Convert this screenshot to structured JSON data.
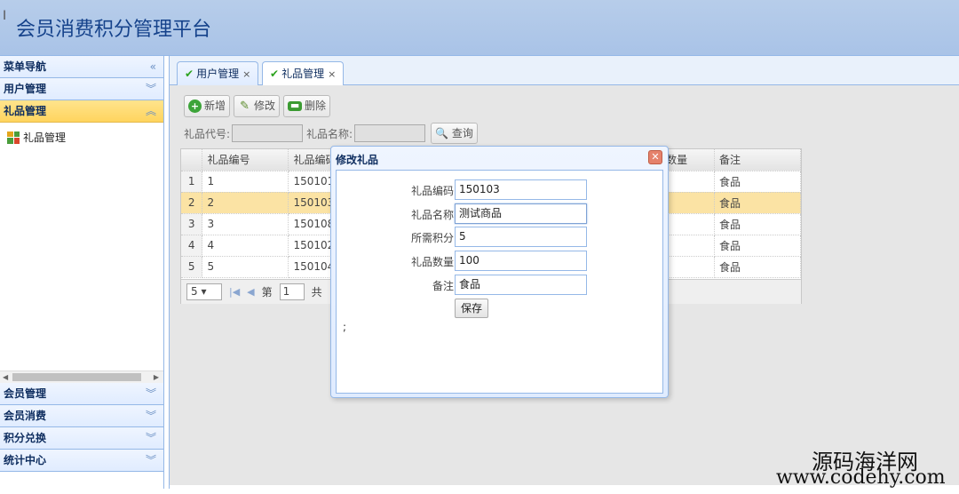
{
  "header": {
    "title": "会员消费积分管理平台"
  },
  "sidebar": {
    "nav_title": "菜单导航",
    "sections_top": [
      {
        "label": "用户管理"
      },
      {
        "label": "礼品管理",
        "active": true
      }
    ],
    "tree_item": "礼品管理",
    "sections_bottom": [
      {
        "label": "会员管理"
      },
      {
        "label": "会员消费"
      },
      {
        "label": "积分兑换"
      },
      {
        "label": "统计中心"
      }
    ]
  },
  "tabs": [
    {
      "label": "用户管理"
    },
    {
      "label": "礼品管理",
      "active": true
    }
  ],
  "toolbar": {
    "add": "新增",
    "edit": "修改",
    "delete": "删除"
  },
  "search": {
    "code_label": "礼品代号:",
    "name_label": "礼品名称:",
    "query": "查询"
  },
  "grid": {
    "columns": [
      "礼品编号",
      "礼品编码",
      "",
      "",
      "",
      "量",
      "备注"
    ],
    "header_visible": {
      "c1": "礼品编号",
      "c2": "礼品编码",
      "c5": "数量",
      "c6": "备注"
    },
    "rows": [
      {
        "rn": "1",
        "id": "1",
        "code": "150101",
        "note": "食品"
      },
      {
        "rn": "2",
        "id": "2",
        "code": "150103",
        "note": "食品",
        "selected": true
      },
      {
        "rn": "3",
        "id": "3",
        "code": "150108",
        "note": "食品"
      },
      {
        "rn": "4",
        "id": "4",
        "code": "150102",
        "note": "食品"
      },
      {
        "rn": "5",
        "id": "5",
        "code": "150104",
        "note": "食品"
      }
    ],
    "pager": {
      "page_size": "5",
      "page_label": "第",
      "page_value": "1",
      "total_label": "共"
    }
  },
  "dialog": {
    "title": "修改礼品",
    "fields": [
      {
        "label": "礼品编码",
        "value": "150103"
      },
      {
        "label": "礼品名称",
        "value": "测试商品",
        "focus": true
      },
      {
        "label": "所需积分",
        "value": "5"
      },
      {
        "label": "礼品数量",
        "value": "100"
      },
      {
        "label": "备注",
        "value": "食品"
      }
    ],
    "save": "保存",
    "trailing_text": ";"
  },
  "watermark": {
    "line1": "源码海洋网",
    "line2": "www.codehy.com"
  }
}
